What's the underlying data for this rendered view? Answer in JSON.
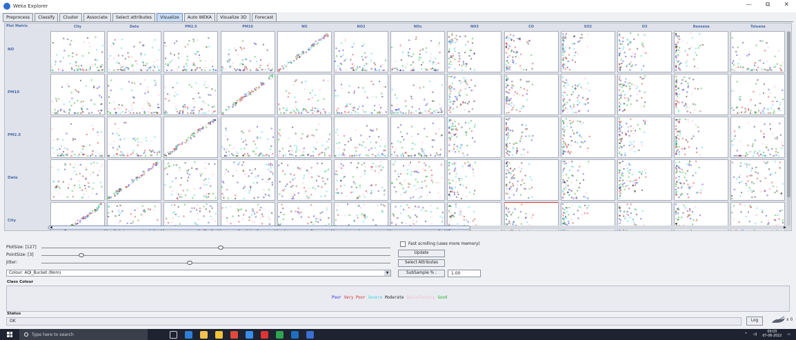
{
  "window": {
    "title": "Weka Explorer",
    "minimize_icon": "minimize-icon",
    "restore_icon": "restore-icon",
    "close_icon": "close-icon",
    "minimize_glyph": "—",
    "restore_glyph": "⧉",
    "close_glyph": "✕"
  },
  "tabs": [
    {
      "label": "Preprocess",
      "active": false
    },
    {
      "label": "Classify",
      "active": false
    },
    {
      "label": "Cluster",
      "active": false
    },
    {
      "label": "Associate",
      "active": false
    },
    {
      "label": "Select attributes",
      "active": false
    },
    {
      "label": "Visualize",
      "active": true
    },
    {
      "label": "Auto WEKA",
      "active": false
    },
    {
      "label": "Visualize 3D",
      "active": false
    },
    {
      "label": "Forecast",
      "active": false
    }
  ],
  "plot_matrix": {
    "corner_label": "Plot Matrix",
    "columns": [
      "City",
      "Date",
      "PM2.5",
      "PM10",
      "NO",
      "NO2",
      "NOx",
      "NH3",
      "CO",
      "SO2",
      "O3",
      "Benzene",
      "Toluene"
    ],
    "rows": [
      "NO",
      "PM10",
      "PM2.5",
      "Date",
      "City"
    ],
    "selected_cell": {
      "row": "City",
      "column": "CO"
    }
  },
  "controls": {
    "plot_size_label": "PlotSize: [127]",
    "plot_size_value": 127,
    "point_size_label": "PointSize: [3]",
    "point_size_value": 3,
    "jitter_label": "Jitter:",
    "jitter_fraction": 0.5,
    "colour_select": "Colour: AQI_Bucket  (Nom)",
    "fast_scrolling_label": "Fast scrolling (uses more memory)",
    "fast_scrolling_checked": false,
    "update_button": "Update",
    "select_attributes_button": "Select Attributes",
    "subsample_button": "SubSample % :",
    "subsample_value": "1.00"
  },
  "class_colour": {
    "title": "Class Colour",
    "entries": [
      {
        "label": "Poor",
        "color": "#2b2bd8"
      },
      {
        "label": "Very Poor",
        "color": "#d12b2b"
      },
      {
        "label": "Severe",
        "color": "#38d0e0"
      },
      {
        "label": "Moderate",
        "color": "#2a2a2a"
      },
      {
        "label": "Satisfactory",
        "color": "#f4b8c6"
      },
      {
        "label": "Good",
        "color": "#22b022"
      }
    ]
  },
  "status": {
    "title": "Status",
    "message": "OK",
    "log_button": "Log",
    "x_label": "x 0"
  },
  "taskbar": {
    "search_placeholder": "Type here to search",
    "icons": [
      "task-view-icon",
      "edge-icon",
      "store-icon",
      "explorer-icon",
      "chrome-icon",
      "mail-icon",
      "opera-icon",
      "chrome-alt-icon",
      "outlook-icon",
      "weka-icon"
    ],
    "time": "00:03",
    "date": "07-06-2022"
  }
}
